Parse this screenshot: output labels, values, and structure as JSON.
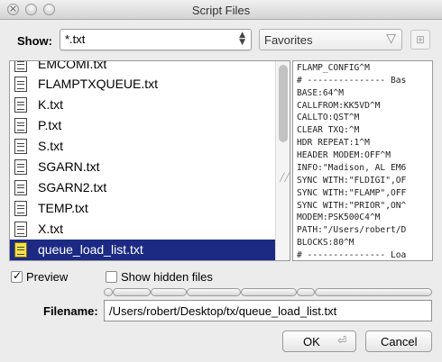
{
  "window": {
    "title": "Script Files"
  },
  "show": {
    "label": "Show:",
    "filter_value": "*.txt",
    "favorites_value": "Favorites"
  },
  "files": [
    {
      "name": "EMCOMI.txt",
      "selected": false
    },
    {
      "name": "FLAMPTXQUEUE.txt",
      "selected": false
    },
    {
      "name": "K.txt",
      "selected": false
    },
    {
      "name": "P.txt",
      "selected": false
    },
    {
      "name": "S.txt",
      "selected": false
    },
    {
      "name": "SGARN.txt",
      "selected": false
    },
    {
      "name": "SGARN2.txt",
      "selected": false
    },
    {
      "name": "TEMP.txt",
      "selected": false
    },
    {
      "name": "X.txt",
      "selected": false
    },
    {
      "name": "queue_load_list.txt",
      "selected": true
    }
  ],
  "preview_lines": [
    "FLAMP_CONFIG^M",
    "# --------------- Bas",
    "BASE:64^M",
    "CALLFROM:KK5VD^M",
    "CALLTO:QST^M",
    "CLEAR TXQ:^M",
    "HDR REPEAT:1^M",
    "HEADER MODEM:OFF^M",
    "INFO:\"Madison, AL EM6",
    "SYNC WITH:\"FLDIGI\",OF",
    "SYNC WITH:\"FLAMP\",OFF",
    "SYNC WITH:\"PRIOR\",ON^",
    "MODEM:PSK500C4^M",
    "PATH:\"/Users/robert/D",
    "BLOCKS:80^M",
    "# --------------- Loa"
  ],
  "options": {
    "preview_label": "Preview",
    "preview_checked": true,
    "hidden_label": "Show hidden files",
    "hidden_checked": false
  },
  "filename": {
    "label": "Filename:",
    "value": "/Users/robert/Desktop/tx/queue_load_list.txt"
  },
  "buttons": {
    "ok": "OK",
    "cancel": "Cancel"
  },
  "colors": {
    "selection": "#1c2a84",
    "selected_icon": "#f5e14a"
  }
}
